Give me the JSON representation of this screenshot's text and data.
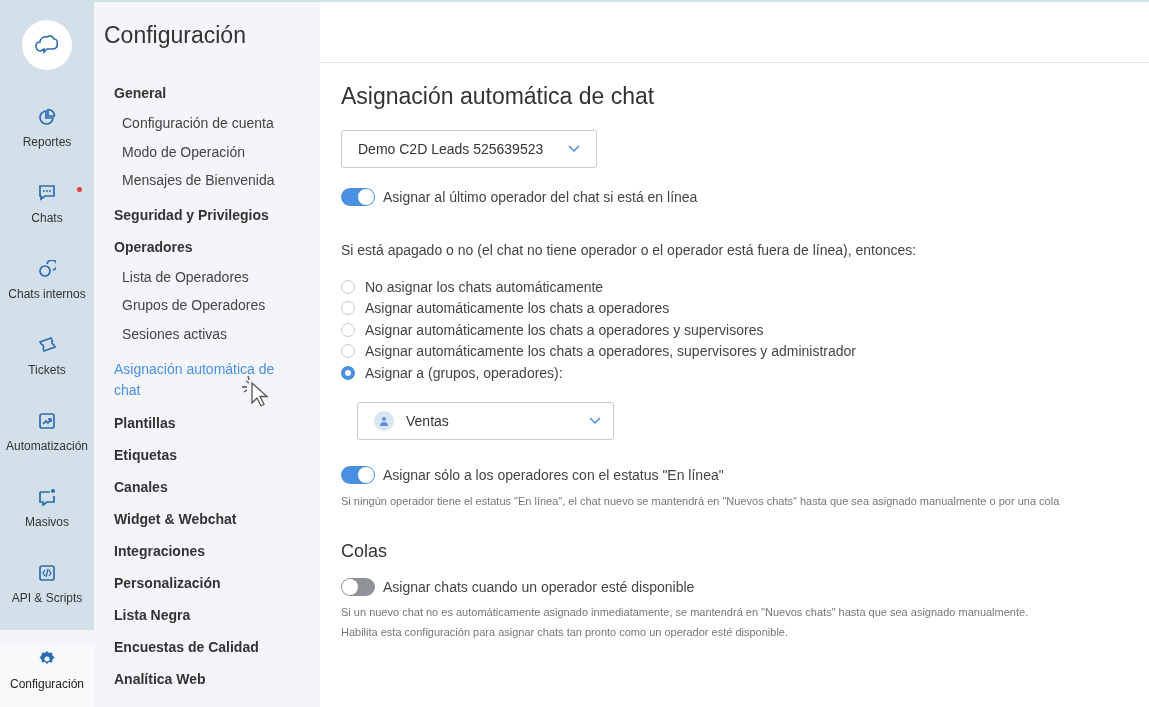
{
  "rail": {
    "items": [
      {
        "label": "Reportes",
        "selected": false,
        "notification": false
      },
      {
        "label": "Chats",
        "selected": false,
        "notification": true
      },
      {
        "label": "Chats internos",
        "selected": false,
        "notification": false
      },
      {
        "label": "Tickets",
        "selected": false,
        "notification": false
      },
      {
        "label": "Automatización",
        "selected": false,
        "notification": false
      },
      {
        "label": "Masivos",
        "selected": false,
        "notification": false
      },
      {
        "label": "API & Scripts",
        "selected": false,
        "notification": false
      },
      {
        "label": "Configuración",
        "selected": true,
        "notification": false
      }
    ]
  },
  "settings_menu": {
    "title": "Configuración",
    "items": [
      {
        "label": "General",
        "selected": false,
        "children": [
          {
            "label": "Configuración de cuenta",
            "selected": false
          },
          {
            "label": "Modo de Operación",
            "selected": false
          },
          {
            "label": "Mensajes de Bienvenida",
            "selected": false
          }
        ]
      },
      {
        "label": "Seguridad y Privilegios",
        "selected": false
      },
      {
        "label": "Operadores",
        "selected": false,
        "children": [
          {
            "label": "Lista de Operadores",
            "selected": false
          },
          {
            "label": "Grupos de Operadores",
            "selected": false
          },
          {
            "label": "Sesiones activas",
            "selected": false
          }
        ]
      },
      {
        "label": "Asignación automática de chat",
        "selected": true
      },
      {
        "label": "Plantillas",
        "selected": false
      },
      {
        "label": "Etiquetas",
        "selected": false
      },
      {
        "label": "Canales",
        "selected": false
      },
      {
        "label": "Widget & Webchat",
        "selected": false
      },
      {
        "label": "Integraciones",
        "selected": false
      },
      {
        "label": "Personalización",
        "selected": false
      },
      {
        "label": "Lista Negra",
        "selected": false
      },
      {
        "label": "Encuestas de Calidad",
        "selected": false
      },
      {
        "label": "Analítica Web",
        "selected": false
      }
    ]
  },
  "main": {
    "title": "Asignación automática de chat",
    "channel_select": {
      "value": "Demo C2D Leads 525639523"
    },
    "last_operator_toggle": {
      "label": "Asignar al último operador del chat si está en línea",
      "on": true
    },
    "fallback_text": "Si está apagado o no (el chat no tiene operador o el operador está fuera de línea), entonces:",
    "options": [
      {
        "label": "No asignar los chats automáticamente",
        "selected": false
      },
      {
        "label": "Asignar automáticamente los chats a operadores",
        "selected": false
      },
      {
        "label": "Asignar automáticamente los chats a operadores y supervisores",
        "selected": false
      },
      {
        "label": "Asignar automáticamente los chats a operadores, supervisores y administrador",
        "selected": false
      },
      {
        "label": "Asignar a (grupos, operadores):",
        "selected": true
      }
    ],
    "group_select": {
      "value": "Ventas"
    },
    "online_toggle": {
      "label": "Asignar sólo a los operadores con el estatus \"En línea\"",
      "on": true,
      "note": [
        "Si ningún operador tiene el estatus \"En línea\", el chat nuevo se mantendrá en \"Nuevos chats\" hasta que sea asignado manualmente o por una cola"
      ]
    },
    "queues": {
      "title": "Colas",
      "toggle": {
        "label": "Asignar chats cuando un operador esté disponible",
        "on": false,
        "note": [
          "Si un nuevo chat no es automáticamente asignado inmediatamente, se mantendrá en \"Nuevos chats\" hasta que sea asignado manualmente.",
          "Habilita esta configuración para asignar chats tan pronto como un operador esté disponible."
        ]
      }
    }
  }
}
